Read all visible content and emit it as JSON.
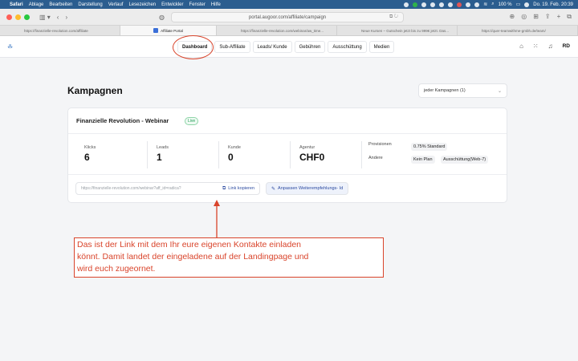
{
  "menubar": {
    "app": "Safari",
    "items": [
      "Ablage",
      "Bearbeiten",
      "Darstellung",
      "Verlauf",
      "Lesezeichen",
      "Entwickler",
      "Fenster",
      "Hilfe"
    ],
    "battery": "100 %",
    "datetime": "Do. 19. Feb. 20:39"
  },
  "browser": {
    "address": "portal.augoor.com/affiliate/campaign",
    "tabs": [
      "https://finanzielle-revolution.com/affiliate",
      "Affiliate Portal",
      "https://finanzielle-revolution.com/webinar/aw_time...",
      "Neue Kursen – Gutschein jetzt bis zu 999€ jetzt. Das...",
      "https://quer-teamwithme-gmbh.de/team/"
    ]
  },
  "nav": {
    "items": [
      "Dashboard",
      "Sub-Affiliate",
      "Leads/ Kunde",
      "Gebühren",
      "Ausschüttung",
      "Medien"
    ],
    "user_initials": "RD"
  },
  "page": {
    "title": "Kampagnen",
    "filter_select": "jeder Kampagnen (1)"
  },
  "campaign": {
    "name": "Finanzielle Revolution - Webinar",
    "status": "Live",
    "stats": [
      {
        "label": "Klicks",
        "value": "6"
      },
      {
        "label": "Leads",
        "value": "1"
      },
      {
        "label": "Kunde",
        "value": "0"
      },
      {
        "label": "Agentur",
        "value": "CHF0"
      }
    ],
    "provisionen_label": "Provisionen",
    "provisionen_value": "0.75% Standard",
    "andere_label": "Andere",
    "andere_values": [
      "Kein Plan",
      "Ausschüttung(Web-7)"
    ],
    "link_placeholder": "https://finanzielle-revolution.com/webinar?aff_id=radica?",
    "copy_label": "Link kopieren",
    "adjust_label": "Anpassen Weiterempfehlungs- Id"
  },
  "annotation": {
    "line1": "Das ist der Link mit dem Ihr eure eigenen Kontakte einladen",
    "line2": "könnt. Damit landet der eingeladene auf der Landingpage und",
    "line3": "wird euch zugeornet."
  },
  "colors": {
    "accent": "#2b4aa0",
    "annotation": "#d9442b",
    "live": "#1f9d55"
  }
}
